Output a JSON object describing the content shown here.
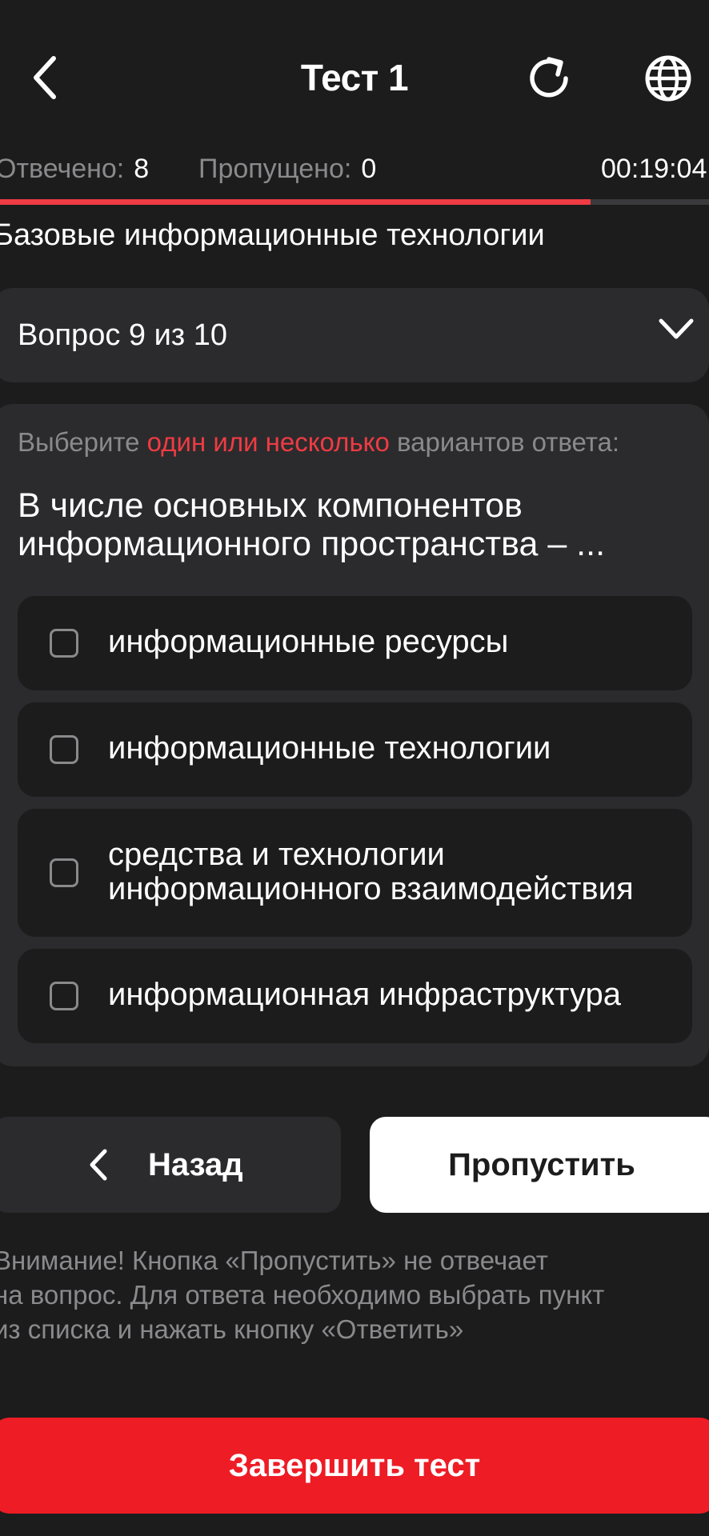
{
  "header": {
    "title": "Тест 1",
    "back_icon": "chevron-left-icon",
    "reload_icon": "reload-icon",
    "language_icon": "globe-icon"
  },
  "stats": {
    "answered_label": "Отвечено:",
    "answered_value": "8",
    "skipped_label": "Пропущено:",
    "skipped_value": "0",
    "timer": "00:19:04"
  },
  "progress": {
    "fraction": 0.833
  },
  "category": "Базовые информационные технологии",
  "selector": {
    "label": "Вопрос 9 из 10"
  },
  "question": {
    "hint_prefix": "Выберите ",
    "hint_accent": "один или несколько",
    "hint_suffix": " вариантов ответа:",
    "text": "В числе основных компонентов информационного пространства – ...",
    "options": [
      {
        "label": "информационные ресурсы",
        "checked": false
      },
      {
        "label": "информационные технологии",
        "checked": false
      },
      {
        "label": "средства и технологии информационного взаимодействия",
        "checked": false
      },
      {
        "label": "информационная инфраструктура",
        "checked": false
      }
    ]
  },
  "buttons": {
    "back_label": "Назад",
    "skip_label": "Пропустить",
    "finish_label": "Завершить тест"
  },
  "warning": {
    "line1": "Внимание! Кнопка «Пропустить» не отвечает",
    "line2": "на вопрос. Для ответа необходимо выбрать пункт",
    "line3": "из списка и нажать кнопку «Ответить»"
  },
  "colors": {
    "background": "#1c1c1d",
    "surface": "#2b2b2d",
    "accent": "#ef3b43",
    "finish": "#ee1c25",
    "muted": "#8a8a8c"
  }
}
